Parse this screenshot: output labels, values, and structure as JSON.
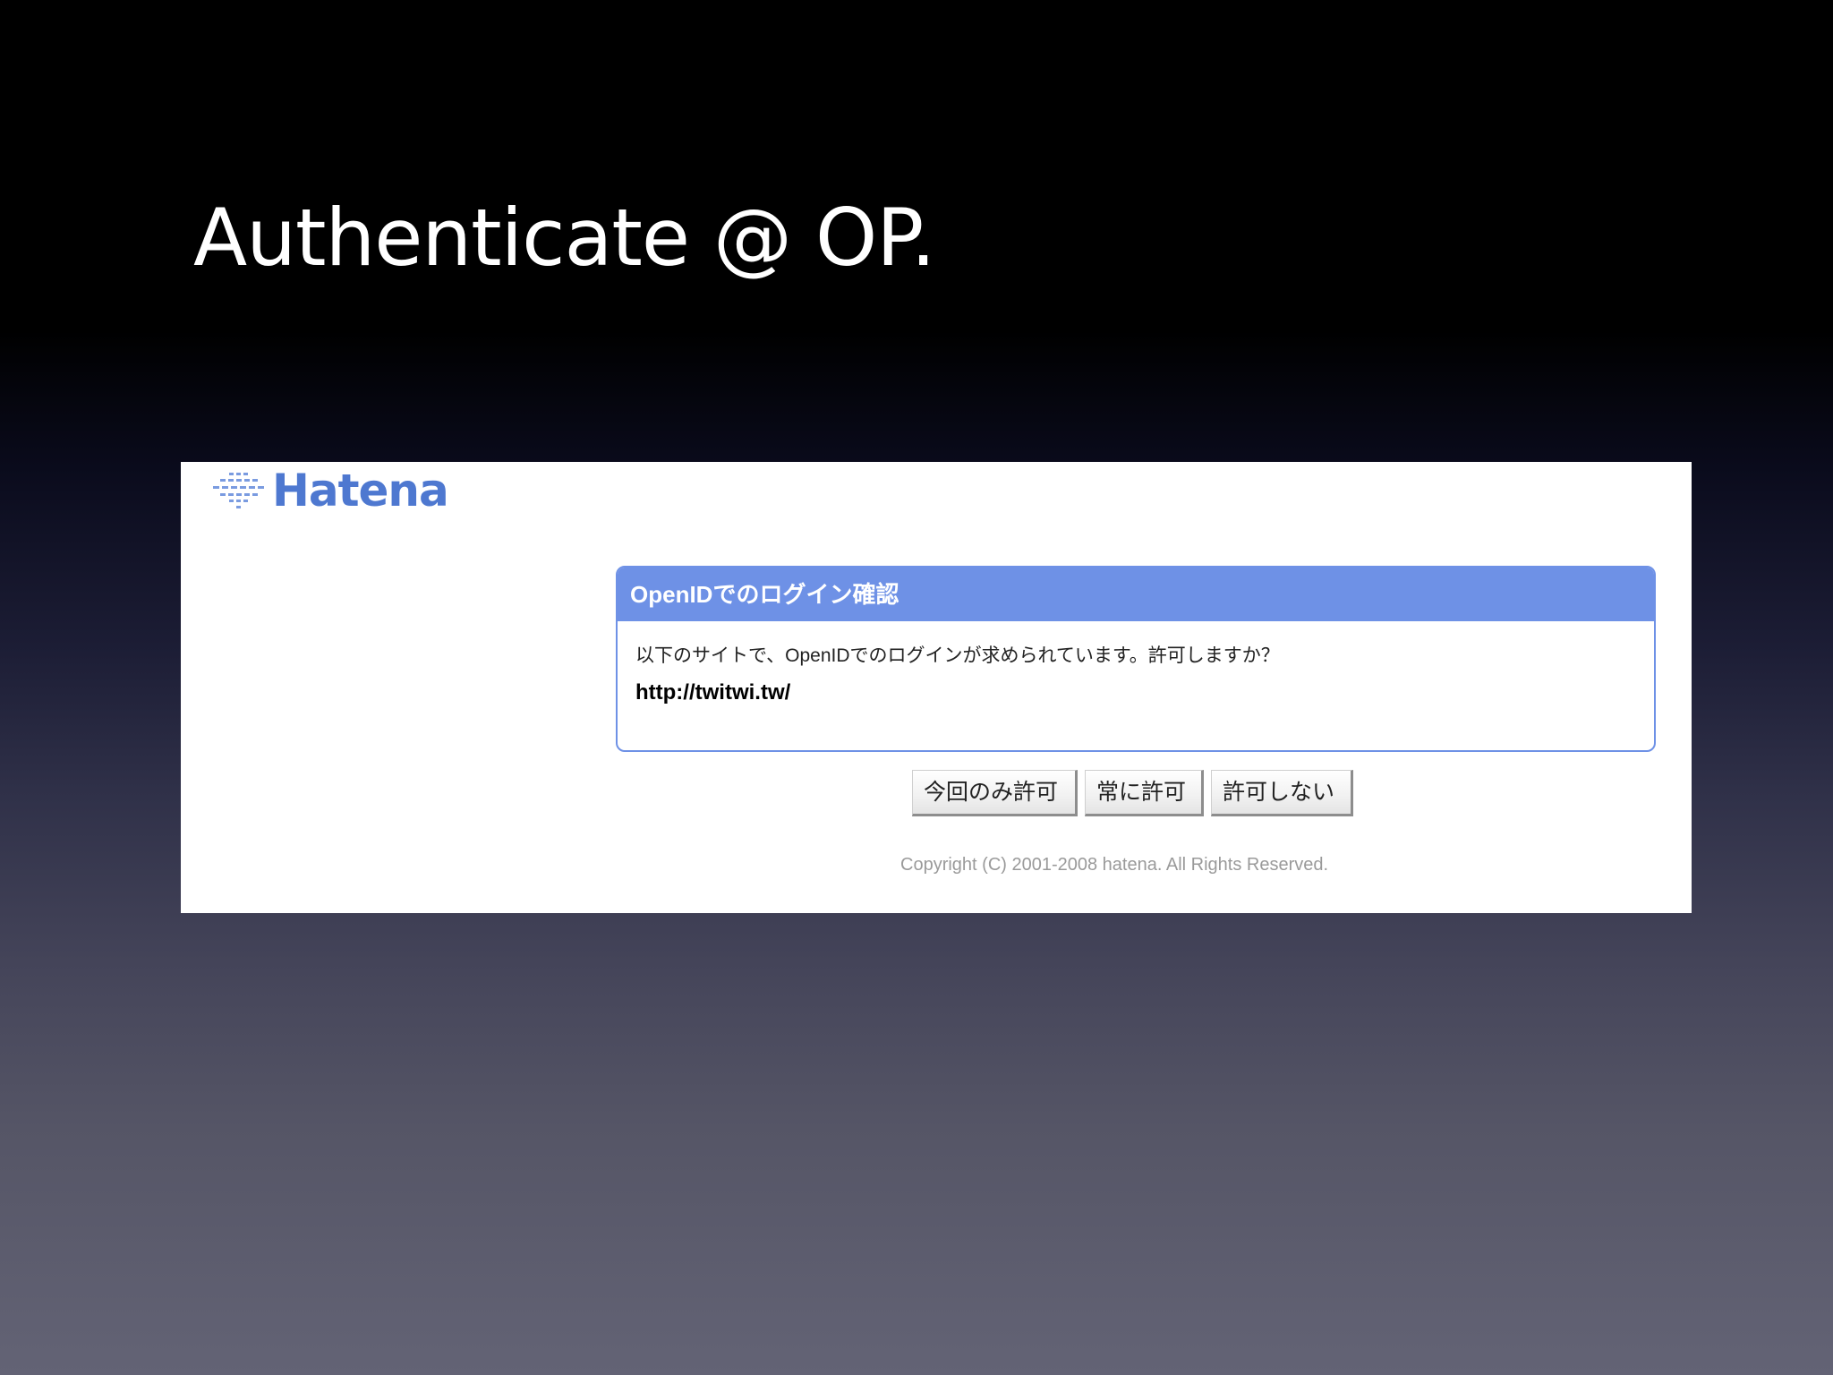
{
  "slide": {
    "title": "Authenticate @ OP."
  },
  "screenshot": {
    "logo": {
      "text": "Hatena",
      "icon": "hatena-logo-mark",
      "color": "#4e78d0"
    },
    "dialog": {
      "header": "OpenIDでのログイン確認",
      "message": "以下のサイトで、OpenIDでのログインが求められています。許可しますか？",
      "url": "http://twitwi.tw/",
      "accent_color": "#6e91e6"
    },
    "buttons": {
      "allow_once": "今回のみ許可",
      "allow_always": "常に許可",
      "deny": "許可しない"
    },
    "copyright": "Copyright (C) 2001-2008 hatena. All Rights Reserved."
  }
}
